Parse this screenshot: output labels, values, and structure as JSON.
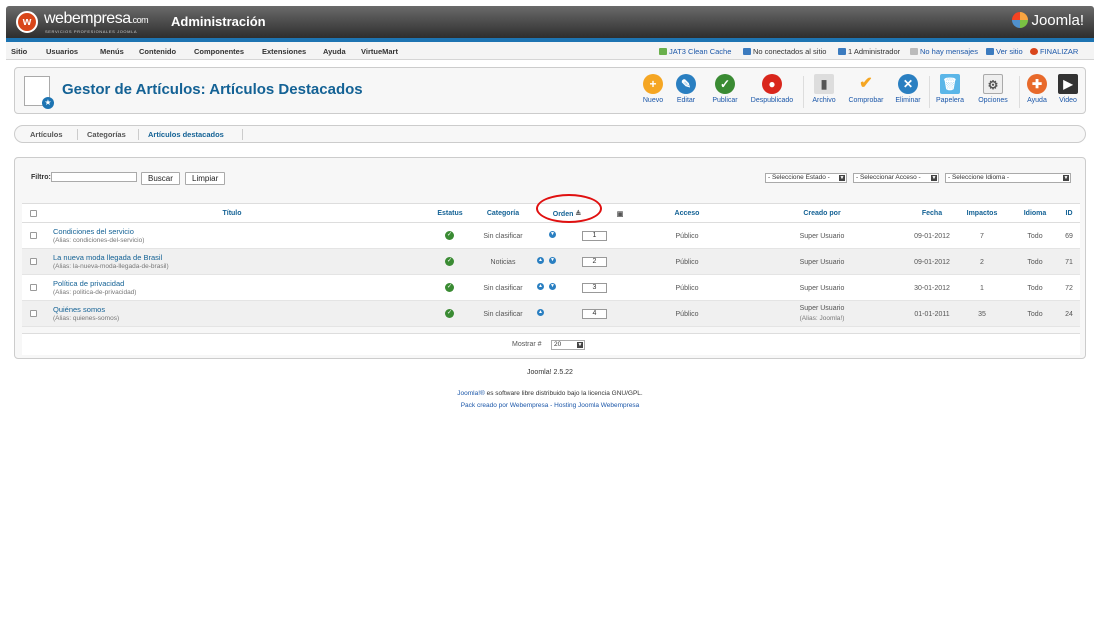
{
  "header": {
    "logo_mark": "w",
    "logo_name": "webempresa",
    "logo_suffix": ".com",
    "logo_tagline": "SERVICIOS PROFESIONALES JOOMLA",
    "title": "Administración",
    "brand": "Joomla!"
  },
  "menu": [
    "Sitio",
    "Usuarios",
    "Menús",
    "Contenido",
    "Componentes",
    "Extensiones",
    "Ayuda",
    "VirtueMart"
  ],
  "status": {
    "cache": "JAT3 Clean Cache",
    "site_users": "No conectados al sitio",
    "admins": "1 Administrador",
    "messages": "No hay mensajes",
    "view_site": "Ver sitio",
    "logout": "FINALIZAR"
  },
  "toolbar": {
    "title": "Gestor de Artículos: Artículos Destacados",
    "buttons": {
      "new": "Nuevo",
      "edit": "Editar",
      "publish": "Publicar",
      "unpublish": "Despublicado",
      "archive": "Archivo",
      "checkin": "Comprobar",
      "delete": "Eliminar",
      "trash": "Papelera",
      "options": "Opciones",
      "help": "Ayuda",
      "video": "Video"
    }
  },
  "subtabs": {
    "articles": "Artículos",
    "categories": "Categorías",
    "featured": "Artículos destacados"
  },
  "filter": {
    "label": "Filtro:",
    "value": "",
    "search_btn": "Buscar",
    "clear_btn": "Limpiar",
    "state_select": "- Seleccione Estado -",
    "access_select": "- Seleccionar Acceso -",
    "language_select": "- Seleccione Idioma -"
  },
  "table": {
    "columns": {
      "title": "Título",
      "status": "Estatus",
      "category": "Categoría",
      "order": "Orden",
      "access": "Acceso",
      "created_by": "Creado por",
      "date": "Fecha",
      "hits": "Impactos",
      "language": "Idioma",
      "id": "ID"
    },
    "rows": [
      {
        "title": "Condiciones del servicio",
        "alias_label": "Alias",
        "alias": ": condiciones-del-servicio)",
        "alias_open": "(",
        "category": "Sin clasificar",
        "order": "1",
        "access": "Público",
        "author": "Super Usuario",
        "author_alias": "",
        "date": "09-01-2012",
        "hits": "7",
        "language": "Todo",
        "id": "69"
      },
      {
        "title": "La nueva moda llegada de Brasil",
        "alias_label": "Alias",
        "alias": ": la-nueva-moda-llegada-de-brasil)",
        "alias_open": "(",
        "category": "Noticias",
        "order": "2",
        "access": "Público",
        "author": "Super Usuario",
        "author_alias": "",
        "date": "09-01-2012",
        "hits": "2",
        "language": "Todo",
        "id": "71"
      },
      {
        "title": "Política de privacidad",
        "alias_label": "Alias",
        "alias": ": politica-de-privacidad)",
        "alias_open": "(",
        "category": "Sin clasificar",
        "order": "3",
        "access": "Público",
        "author": "Super Usuario",
        "author_alias": "",
        "date": "30-01-2012",
        "hits": "1",
        "language": "Todo",
        "id": "72"
      },
      {
        "title": "Quiénes somos",
        "alias_label": "Alias",
        "alias": ": quienes-somos)",
        "alias_open": "(",
        "category": "Sin clasificar",
        "order": "4",
        "access": "Público",
        "author": "Super Usuario",
        "author_alias": "(Alias: Joomla!)",
        "date": "01-01-2011",
        "hits": "35",
        "language": "Todo",
        "id": "24"
      }
    ],
    "show_label": "Mostrar #",
    "show_value": "20"
  },
  "footer": {
    "version": "Joomla! 2.5.22",
    "license_link": "Joomla!®",
    "license_text": " es software libre distribuido bajo la licencia GNU/GPL.",
    "pack": "Pack creado por Webempresa - Hosting Joomla Webempresa"
  },
  "colors": {
    "accent": "#146295",
    "header_blue": "#1d74b2",
    "highlight": "#e01010"
  }
}
